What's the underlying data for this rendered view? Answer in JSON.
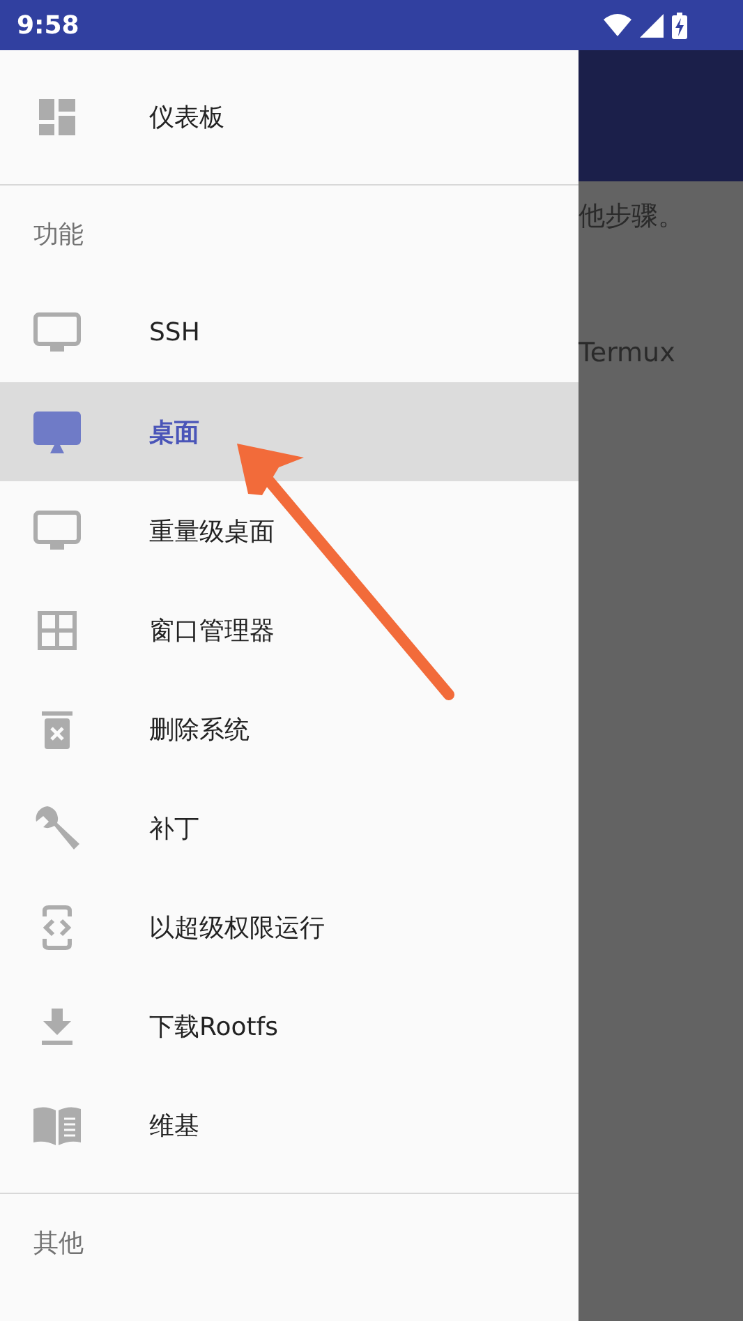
{
  "status_bar": {
    "time": "9:58"
  },
  "drawer": {
    "top_item": {
      "label": "仪表板",
      "selected": false
    },
    "sections": [
      {
        "header": "功能",
        "items": [
          {
            "label": "SSH",
            "selected": false
          },
          {
            "label": "桌面",
            "selected": true
          },
          {
            "label": "重量级桌面",
            "selected": false
          },
          {
            "label": "窗口管理器",
            "selected": false
          },
          {
            "label": "删除系统",
            "selected": false
          },
          {
            "label": "补丁",
            "selected": false
          },
          {
            "label": "以超级权限运行",
            "selected": false
          },
          {
            "label": "下载Rootfs",
            "selected": false
          },
          {
            "label": "维基",
            "selected": false
          }
        ]
      },
      {
        "header": "其他"
      }
    ]
  },
  "background_page": {
    "lines": [
      "他步骤。",
      "Termux"
    ]
  }
}
